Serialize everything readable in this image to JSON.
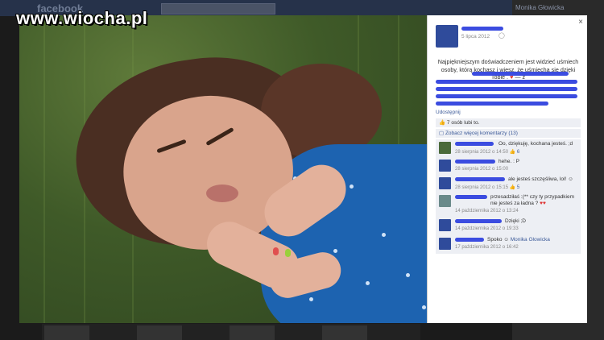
{
  "watermark": "www.wiocha.pl",
  "background": {
    "logo": "facebook",
    "friend_name": "Monika Głowicka"
  },
  "photo": {
    "alt": "photo"
  },
  "panel": {
    "close_label": "×",
    "post_date": "5 lipca 2012",
    "caption": "Najpiękniejszym doświadczeniem jest widzieć uśmiech osoby, którą kochasz i wiesz, że uśmiecha się dzięki Tobie .",
    "caption_heart": "♥",
    "caption_suffix": "— z",
    "share_label": "Udostępnij",
    "likes_text": "7 osób lubi to.",
    "more_comments": "Zobacz więcej komentarzy (13)",
    "comments": [
      {
        "text": "Oo, dziękuję, kochana jesteś. ;d",
        "time": "28 sierpnia 2012 o 14:50",
        "likes": "6"
      },
      {
        "text": "hehe. : P",
        "time": "28 sierpnia 2012 o 15:00",
        "likes": ""
      },
      {
        "text": "ale jesteś szczęśliwa, lol!",
        "time": "28 sierpnia 2012 o 15:15",
        "likes": "5"
      },
      {
        "text": "przesadziłaś :(** czy ty przypadkiem nie jesteś za ładna ?",
        "time": "14 października 2012 o 13:24",
        "likes": ""
      },
      {
        "text": "Dzięki ;D",
        "time": "14 października 2012 o 19:33",
        "likes": ""
      },
      {
        "text": "Spoko",
        "tag": "Monika Głowicka",
        "time": "17 października 2012 o 16:42",
        "likes": ""
      }
    ]
  },
  "colors": {
    "facebook_blue": "#3b5998",
    "scribble_blue": "#3b4ce0",
    "heart_red": "#d33333"
  },
  "icons": [
    "close-icon",
    "globe-icon",
    "thumbs-up-icon",
    "heart-icon",
    "smiley-icon"
  ]
}
